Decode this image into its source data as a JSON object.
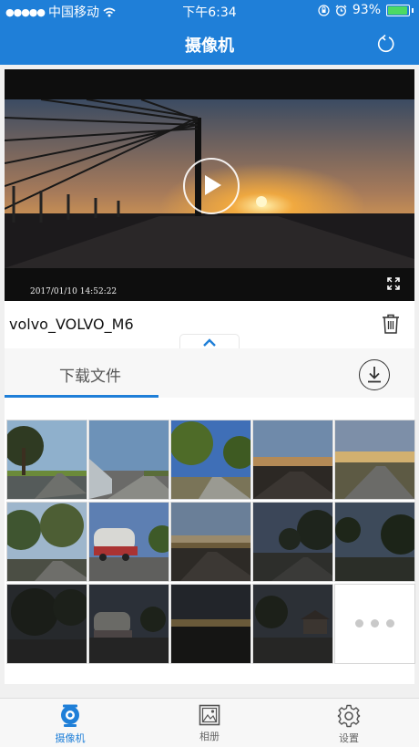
{
  "status_bar": {
    "carrier": "中国移动",
    "time": "下午6:34",
    "battery": "93%"
  },
  "nav": {
    "title": "摄像机",
    "refresh_icon": "refresh-icon"
  },
  "player": {
    "timestamp": "2017/01/10  14:52:22",
    "play_icon": "play-icon",
    "fullscreen_icon": "fullscreen-icon"
  },
  "camera": {
    "name": "volvo_VOLVO_M6",
    "delete_icon": "trash-icon",
    "collapse_icon": "chevron-up-icon"
  },
  "file_tab": {
    "label": "下载文件",
    "download_icon": "download-icon"
  },
  "thumbnails": [
    {
      "scene": "trees-road-day"
    },
    {
      "scene": "highway-fence"
    },
    {
      "scene": "trees-blue-sky"
    },
    {
      "scene": "sunset-road"
    },
    {
      "scene": "golden-road"
    },
    {
      "scene": "gum-trees"
    },
    {
      "scene": "tanker-truck"
    },
    {
      "scene": "dusk-road"
    },
    {
      "scene": "dark-trees"
    },
    {
      "scene": "dark-field"
    },
    {
      "scene": "night-trees"
    },
    {
      "scene": "night-truck"
    },
    {
      "scene": "night-horizon"
    },
    {
      "scene": "night-house"
    }
  ],
  "tab_bar": {
    "camera": "摄像机",
    "album": "相册",
    "settings": "设置"
  },
  "colors": {
    "accent": "#1f7fd8",
    "battery": "#4cd964"
  }
}
